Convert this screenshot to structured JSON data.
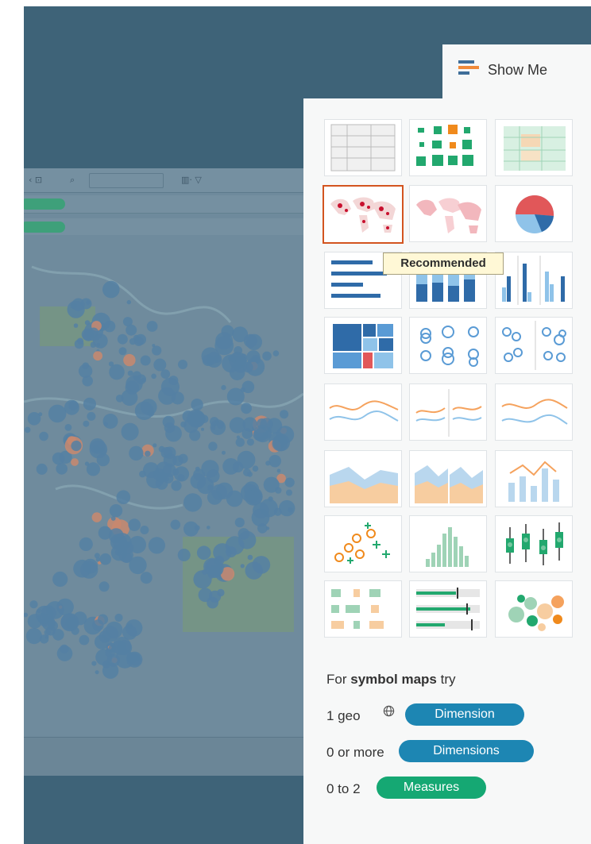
{
  "panel": {
    "title": "Show Me",
    "tooltip": "Recommended",
    "hint": {
      "prefix": "For ",
      "emphasis": "symbol maps",
      "suffix": " try"
    },
    "requirements": [
      {
        "count": "1 geo",
        "badge": "Dimension",
        "kind": "dimension"
      },
      {
        "count": "0 or more",
        "badge": "Dimensions",
        "kind": "dimension"
      },
      {
        "count": "0 to 2",
        "badge": "Measures",
        "kind": "measure"
      }
    ],
    "chart_types": [
      "text-table",
      "heat-map",
      "highlight-table",
      "symbol-map",
      "filled-map",
      "pie-chart",
      "horizontal-bars",
      "stacked-bars",
      "side-by-side-bars",
      "treemap",
      "circle-views",
      "side-by-side-circles",
      "continuous-lines",
      "discrete-lines",
      "dual-lines",
      "area-continuous",
      "area-discrete",
      "dual-combination",
      "scatter-plot",
      "histogram",
      "box-and-whisker",
      "gantt-chart",
      "bullet-graph",
      "packed-bubbles"
    ],
    "selected_chart": "symbol-map"
  },
  "colors": {
    "background": "#3e6378",
    "panel": "#f7f8f8",
    "dimension": "#1d86b3",
    "measure": "#15a873",
    "selection": "#d3541f"
  }
}
